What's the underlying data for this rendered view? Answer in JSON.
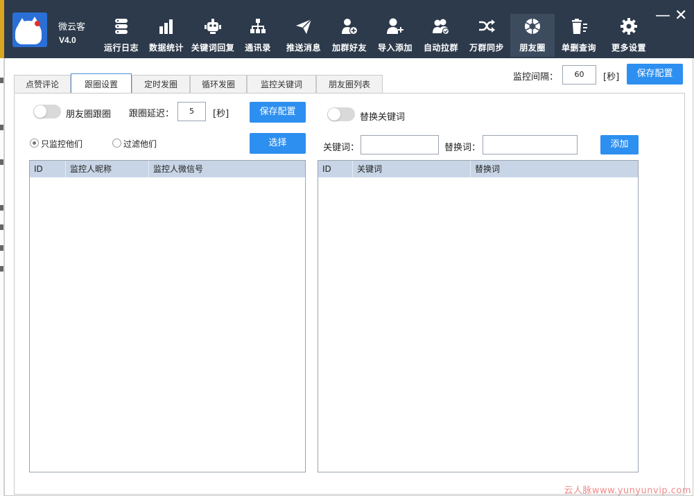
{
  "app": {
    "name": "微云客",
    "version": "V4.0"
  },
  "nav": [
    {
      "label": "运行日志",
      "icon": "database-icon"
    },
    {
      "label": "数据统计",
      "icon": "bar-chart-icon"
    },
    {
      "label": "关键词回复",
      "icon": "robot-icon"
    },
    {
      "label": "通讯录",
      "icon": "org-chart-icon"
    },
    {
      "label": "推送消息",
      "icon": "paper-plane-icon"
    },
    {
      "label": "加群好友",
      "icon": "add-user-icon"
    },
    {
      "label": "导入添加",
      "icon": "user-plus-icon"
    },
    {
      "label": "自动拉群",
      "icon": "group-check-icon"
    },
    {
      "label": "万群同步",
      "icon": "shuffle-icon"
    },
    {
      "label": "朋友圈",
      "icon": "aperture-icon"
    },
    {
      "label": "单删查询",
      "icon": "trash-list-icon"
    },
    {
      "label": "更多设置",
      "icon": "gear-icon"
    }
  ],
  "window": {
    "minimize": "—",
    "close": "✕"
  },
  "tabs": [
    "点赞评论",
    "跟圈设置",
    "定时发圈",
    "循环发圈",
    "监控关键词",
    "朋友圈列表"
  ],
  "active_tab": "跟圈设置",
  "monitor": {
    "label": "监控间隔：",
    "value": "60",
    "unit": "[秒]",
    "save": "保存配置"
  },
  "follow": {
    "toggle_label": "朋友圈跟圈",
    "delay_label": "跟圈延迟：",
    "delay_value": "5",
    "delay_unit": "[秒]",
    "save": "保存配置"
  },
  "replace": {
    "toggle_label": "替换关键词",
    "keyword_label": "关键词：",
    "replace_label": "替换词：",
    "add": "添加"
  },
  "filter": {
    "only_label": "只监控他们",
    "exclude_label": "过滤他们",
    "select": "选择"
  },
  "left_table": {
    "columns": [
      "ID",
      "监控人昵称",
      "监控人微信号"
    ]
  },
  "right_table": {
    "columns": [
      "ID",
      "关键词",
      "替换词"
    ]
  },
  "watermark": "云人脉www.yunyunvip.com",
  "colors": {
    "topbar": "#2d3a4b",
    "accent": "#2d8ff0",
    "grid_header": "#c8d5e6"
  }
}
